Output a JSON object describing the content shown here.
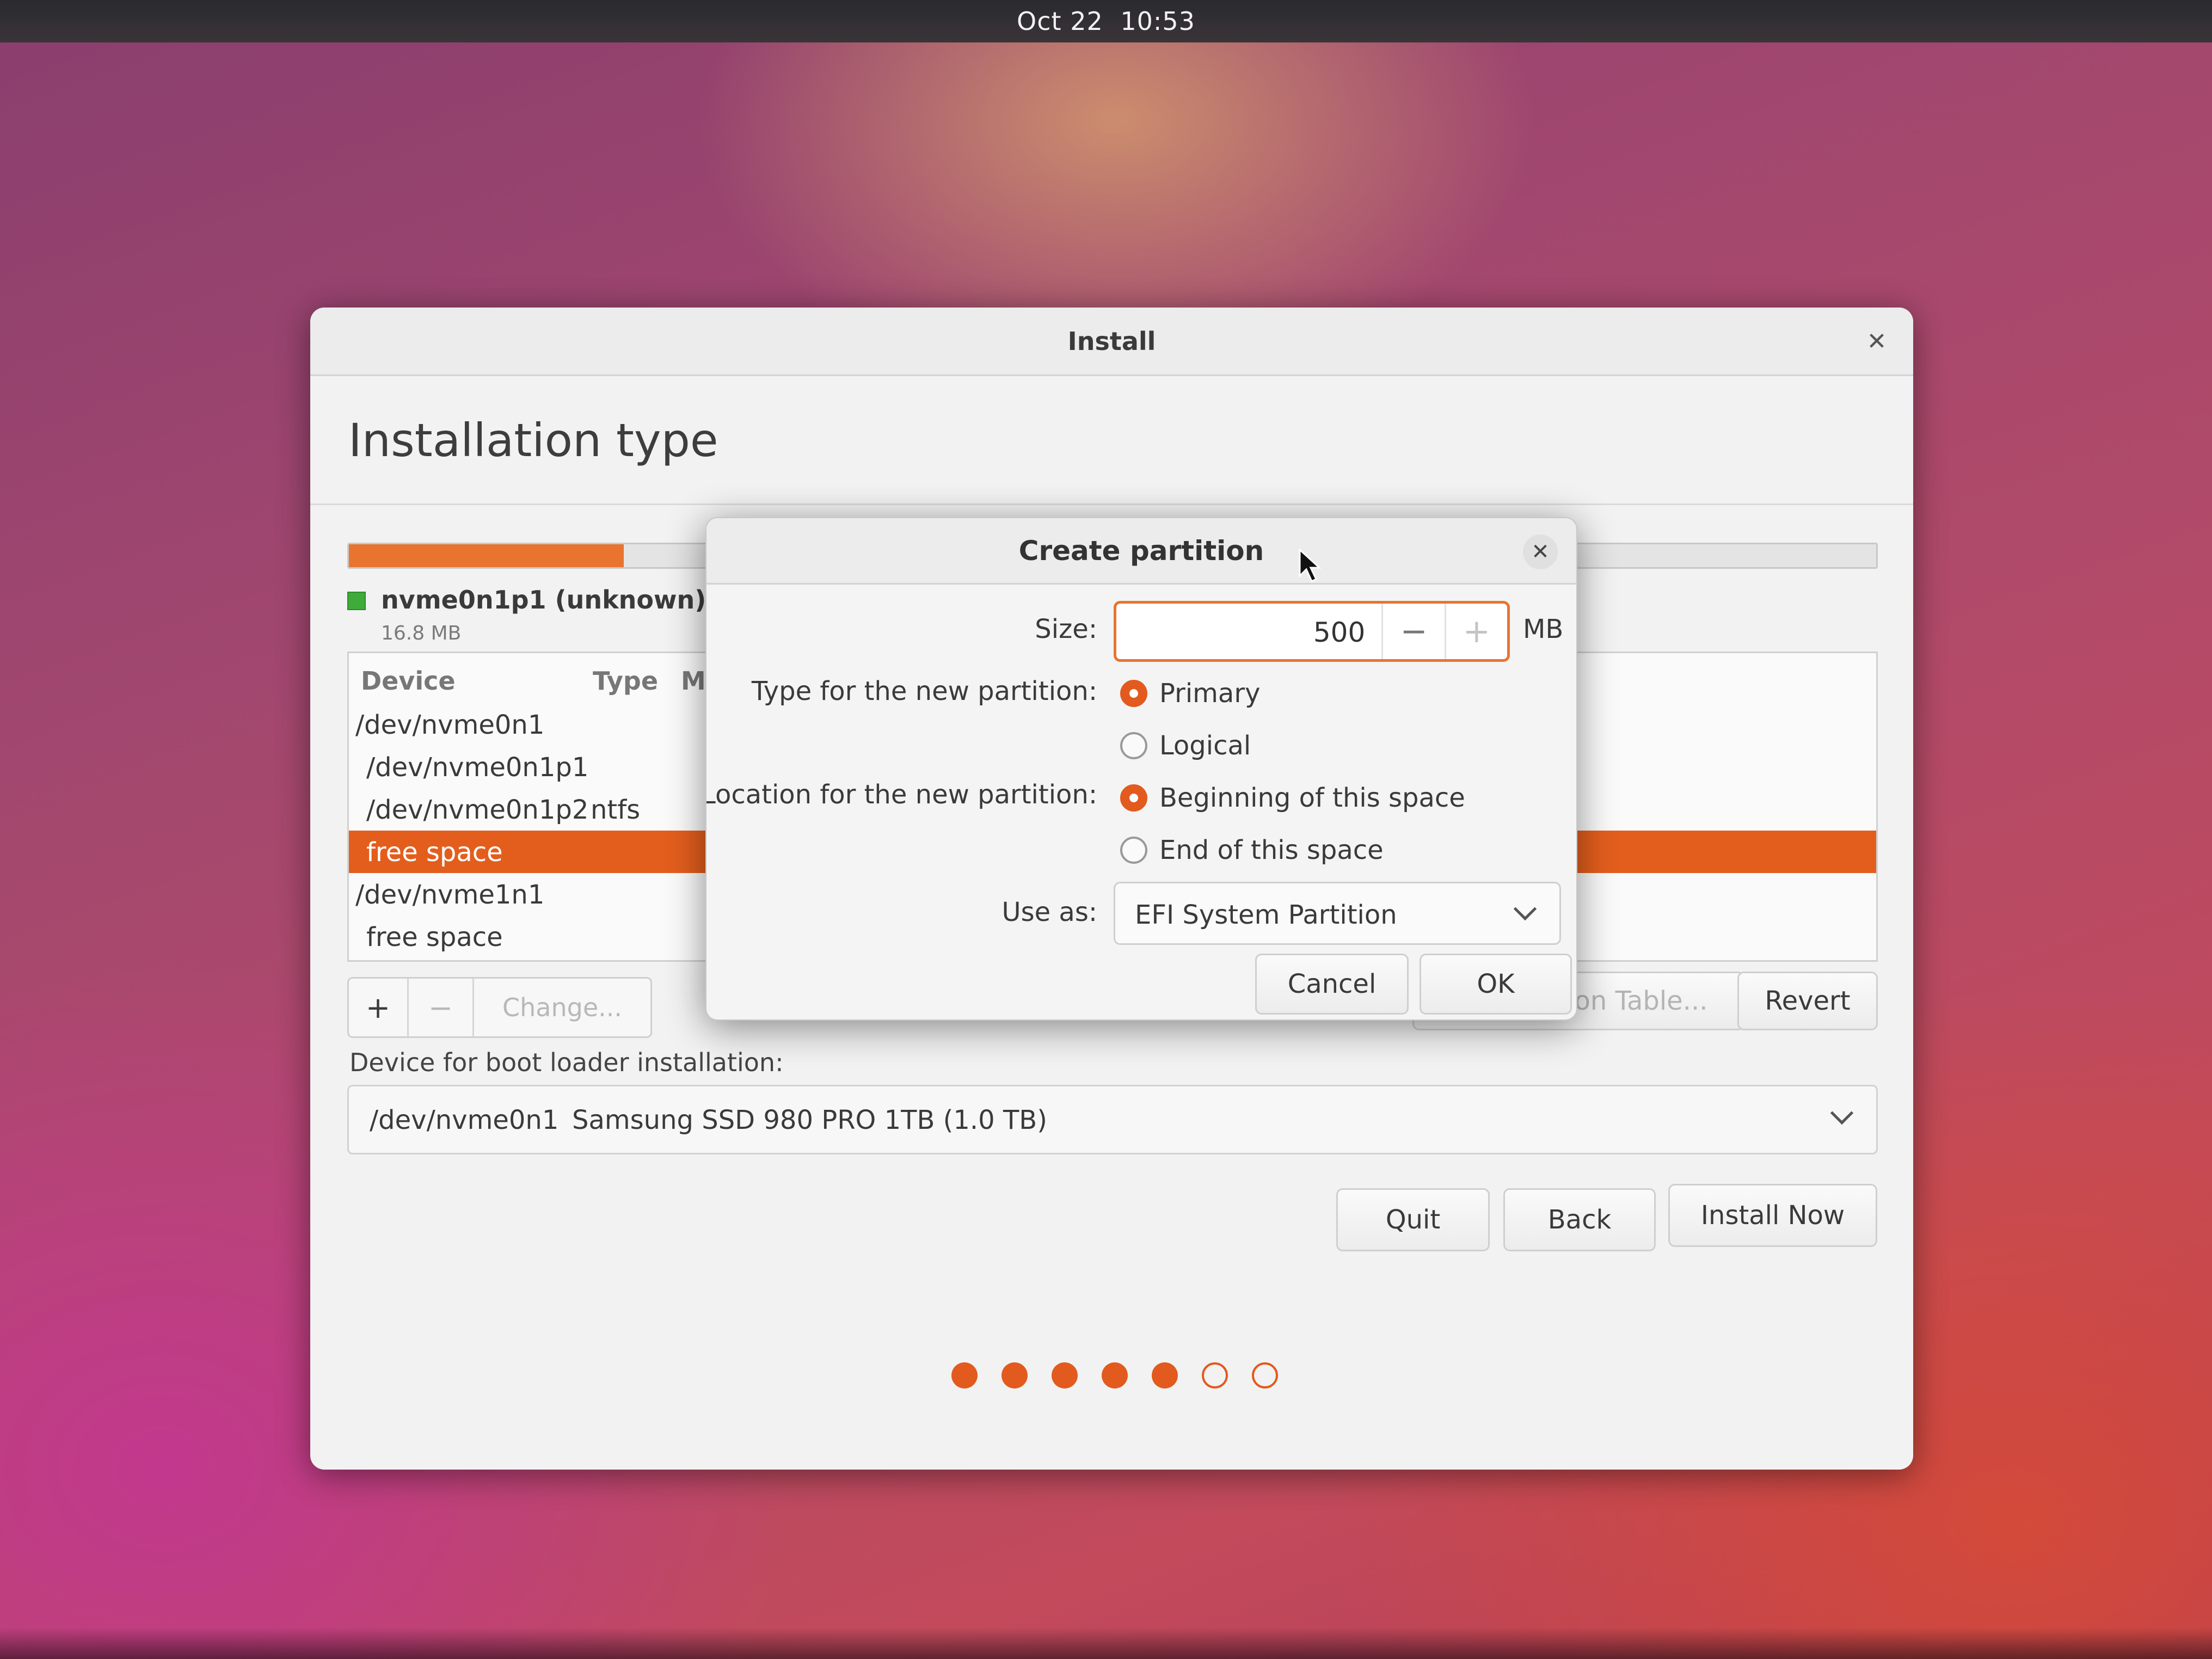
{
  "topbar": {
    "date": "Oct 22",
    "time": "10:53"
  },
  "window": {
    "title": "Install",
    "heading": "Installation type",
    "legend": {
      "name": "nvme0n1p1 (unknown)",
      "size": "16.8 MB"
    },
    "table": {
      "columns": [
        "Device",
        "Type",
        "M"
      ],
      "rows": [
        {
          "device": "/dev/nvme0n1",
          "type": ""
        },
        {
          "device": "/dev/nvme0n1p1",
          "type": ""
        },
        {
          "device": "/dev/nvme0n1p2",
          "type": "ntfs"
        },
        {
          "device": "free space",
          "type": "",
          "selected": true
        },
        {
          "device": "/dev/nvme1n1",
          "type": ""
        },
        {
          "device": "free space",
          "type": ""
        }
      ]
    },
    "toolbar": {
      "add": "+",
      "remove": "−",
      "change": "Change..."
    },
    "partition_table_button": "on Table...",
    "revert_button": "Revert",
    "boot_loader": {
      "label": "Device for boot loader installation:",
      "device": "/dev/nvme0n1",
      "model": "Samsung SSD 980 PRO 1TB (1.0 TB)"
    },
    "buttons": {
      "quit": "Quit",
      "back": "Back",
      "install": "Install Now"
    },
    "progress": {
      "current_step": 5,
      "total_steps": 7
    }
  },
  "dialog": {
    "title": "Create partition",
    "size_label": "Size:",
    "size_value": "500",
    "size_unit": "MB",
    "type_label": "Type for the new partition:",
    "type_options": [
      "Primary",
      "Logical"
    ],
    "type_selected": "Primary",
    "location_label": "Location for the new partition:",
    "location_options": [
      "Beginning of this space",
      "End of this space"
    ],
    "location_selected": "Beginning of this space",
    "use_as_label": "Use as:",
    "use_as_value": "EFI System Partition",
    "cancel": "Cancel",
    "ok": "OK"
  },
  "colors": {
    "accent": "#e25a1d",
    "partition_green": "#3eab3b"
  }
}
